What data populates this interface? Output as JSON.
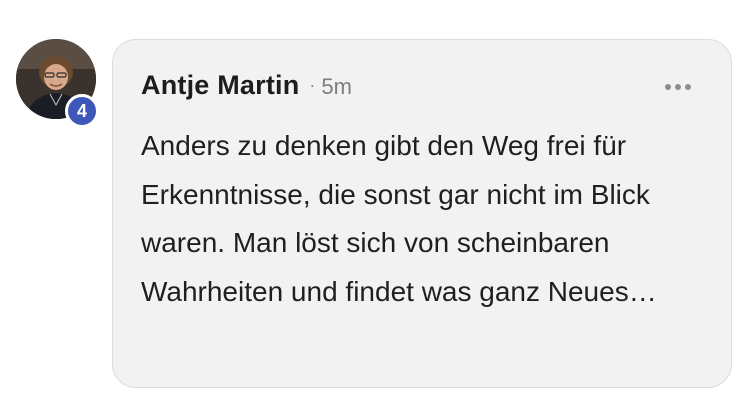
{
  "comment": {
    "avatar": {
      "icon": "profile-photo-icon",
      "badge_count": "4",
      "badge_color": "#3e57b8"
    },
    "author": "Antje Martin",
    "separator": "·",
    "timestamp": "5m",
    "more_icon": "ellipsis-icon",
    "text": "Anders zu denken gibt den Weg frei für Erkenntnisse, die sonst gar nicht im Blick waren. Man löst sich von scheinbaren Wahrheiten und findet was ganz Neues…"
  }
}
